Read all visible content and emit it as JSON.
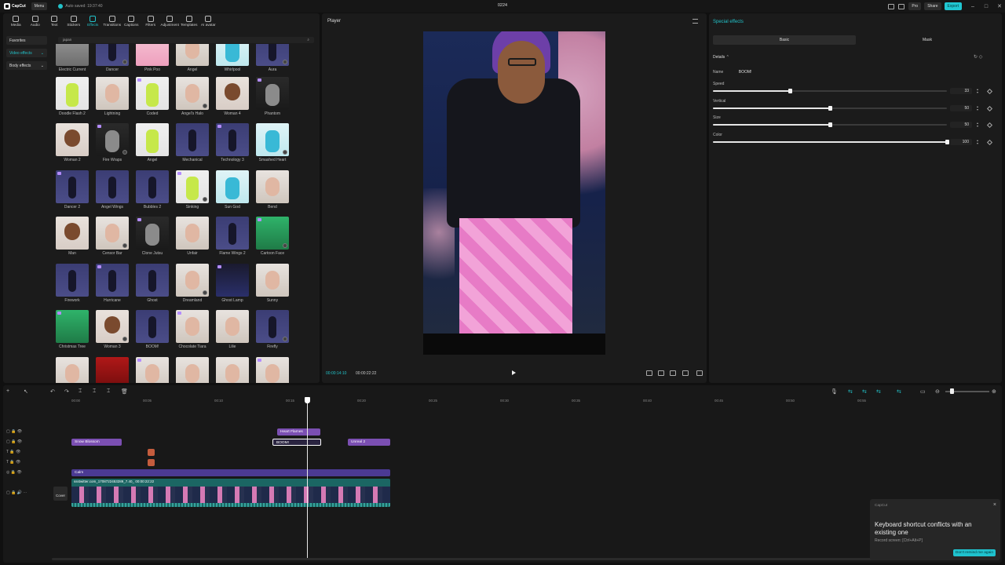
{
  "app": {
    "logo": "CapCut",
    "menu": "Menu",
    "autosave": "Auto saved: 19:37:40",
    "title": "0224",
    "pro": "Pro",
    "share": "Share",
    "export": "Export",
    "accent_color": "#22c2c9",
    "window_controls": [
      "–",
      "□",
      "✕"
    ]
  },
  "toolbar": [
    "Media",
    "Audio",
    "Text",
    "Stickers",
    "Effects",
    "Transitions",
    "Captions",
    "Filters",
    "Adjustment",
    "Templates",
    "AI avatar"
  ],
  "active_tool": "Effects",
  "sidenav": {
    "favorites": "Favorites",
    "video_effects": "Video effects",
    "body_effects": "Body effects"
  },
  "search": {
    "value": "japan"
  },
  "effects": [
    [
      "Electric Current",
      "Dancer",
      "Pink Poo",
      "Angel",
      "Whirlpool",
      "Aura"
    ],
    [
      "Doodle Flash 2",
      "Lightning",
      "Coded",
      "Angel's Halo",
      "Woman 4",
      "Phantom"
    ],
    [
      "Woman 2",
      "Fire Wraps",
      "Angel",
      "Mechanical",
      "Technology 3",
      "Smashed Heart"
    ],
    [
      "Dancer 2",
      "Angel Wings",
      "Bubbles 2",
      "Sinking",
      "Sun God",
      "Bend"
    ],
    [
      "Man",
      "Censor Bar",
      "Clone Jutsu",
      "Unfair",
      "Flame Wings 2",
      "Cartoon Face"
    ],
    [
      "Firework",
      "Hurricane",
      "Ghost",
      "Dreamland",
      "Ghost Lamp",
      "Sunny"
    ],
    [
      "Christmas Tree",
      "Woman 3",
      "BOOM!",
      "Chocolate Tiara",
      "Lilie",
      "Firefly"
    ],
    [
      "",
      "",
      "",
      "",
      "",
      ""
    ]
  ],
  "player": {
    "title": "Player",
    "current_time": "00:00:14:10",
    "total_time": "00:00:22:22"
  },
  "special_effects": {
    "title": "Special effects",
    "tabs": [
      "Basic",
      "Mask"
    ],
    "details": "Details",
    "name_label": "Name",
    "name_value": "BOOM!",
    "params": [
      {
        "label": "Speed",
        "value": 33
      },
      {
        "label": "Vertical",
        "value": 50
      },
      {
        "label": "Size",
        "value": 50
      },
      {
        "label": "Color",
        "value": 100
      }
    ]
  },
  "timeline": {
    "ticks": [
      "00:00",
      "00:05",
      "00:10",
      "00:15",
      "00:20",
      "00:25",
      "00:30",
      "00:35",
      "00:40",
      "00:45",
      "00:50",
      "00:55"
    ],
    "clips": {
      "heart_flames": "Heart Flames",
      "snow_blossom": "Snow Blossom",
      "boom": "BOOM!",
      "unreal2": "Unreal 2",
      "calm": "Calm"
    },
    "main_video": {
      "name": "ssstwitter.com_1708722453289_7.40_",
      "duration": "00:00:22:22"
    },
    "cover": "Cover"
  },
  "toast": {
    "brand": "CapCut",
    "title": "Keyboard shortcut conflicts with an existing one",
    "sub": "Record screen: [Ctrl+Alt+P]",
    "button": "Don't remind me again"
  }
}
